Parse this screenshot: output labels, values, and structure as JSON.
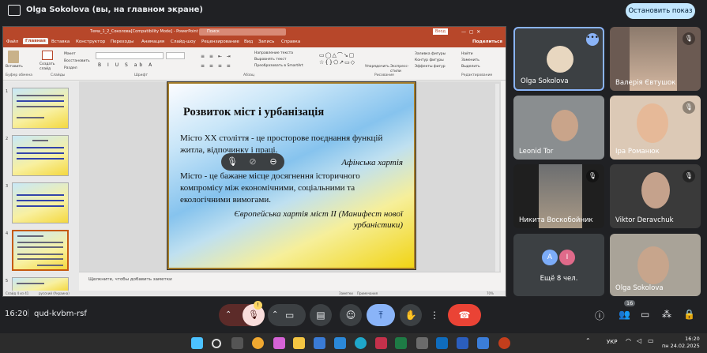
{
  "topbar": {
    "title": "Olga Sokolova (вы, на главном экране)",
    "stop_button": "Остановить показ"
  },
  "powerpoint": {
    "titlebar": "Тема_1_2_Соколова[Compatibility Mode] - PowerPoint",
    "search": "Поиск",
    "account": "Вход",
    "tabs": [
      "Файл",
      "Главная",
      "Вставка",
      "Конструктор",
      "Переходы",
      "Анимация",
      "Слайд-шоу",
      "Рецензирование",
      "Вид",
      "Запись",
      "Справка"
    ],
    "share": "Поделиться",
    "ribbon": {
      "paste": "Вставить",
      "new_slide": "Создать слайд",
      "layout": "Макет",
      "reset": "Восстановить",
      "section": "Раздел",
      "find": "Найти",
      "replace": "Заменить",
      "select": "Выделить",
      "arrange": "Упорядочить",
      "quick_styles": "Экспресс-стили",
      "shape_fill": "Заливка фигуры",
      "shape_outline": "Контур фигуры",
      "shape_effects": "Эффекты фигур",
      "text_direction": "Направление текста",
      "align_text": "Выровнять текст",
      "convert_smartart": "Преобразовать в SmartArt",
      "groups": [
        "Буфер обмена",
        "Слайды",
        "Шрифт",
        "Абзац",
        "Рисование",
        "Редактирование"
      ]
    },
    "slide": {
      "title": "Розвиток міст і урбанізація",
      "p1": "Місто ХХ століття - це просторове поєднання функцій житла, відпочинку і праці.",
      "q1": "Афінська хартія",
      "p2": "Місто - це бажане місце досягнення історичного компромісу між економічними, соціальними та екологічними вимогами.",
      "q2": "Європейська хартія міст ІІ (Манифест нової урбаністики)"
    },
    "thumbs": [
      "1",
      "2",
      "3",
      "4",
      "5"
    ],
    "notes_placeholder": "Щелкните, чтобы добавить заметки",
    "status": {
      "slide": "Слайд 4 из 41",
      "lang": "русский (Украина)",
      "notes": "Заметки",
      "comments": "Примечания",
      "zoom": "70%"
    }
  },
  "participants": [
    {
      "name": "Olga Sokolova"
    },
    {
      "name": "Валерія Євтушок"
    },
    {
      "name": "Leonid Tor"
    },
    {
      "name": "Іра Романюк"
    },
    {
      "name": "Никита Воскобойник"
    },
    {
      "name": "Viktor Deravchuk"
    },
    {
      "name": "Ещё 8 чел.",
      "avatars": [
        "A",
        "I"
      ]
    },
    {
      "name": "Olga Sokolova"
    }
  ],
  "call": {
    "time": "16:20",
    "code": "qud-kvbm-rsf",
    "participants_badge": "16",
    "warning": "!"
  },
  "taskbar": {
    "lang": "УКР",
    "time": "16:20",
    "date": "пн 24.02.2025"
  },
  "colors": {
    "ppt_accent": "#b7472a",
    "end_call": "#ea4335",
    "present": "#8ab4f8"
  }
}
